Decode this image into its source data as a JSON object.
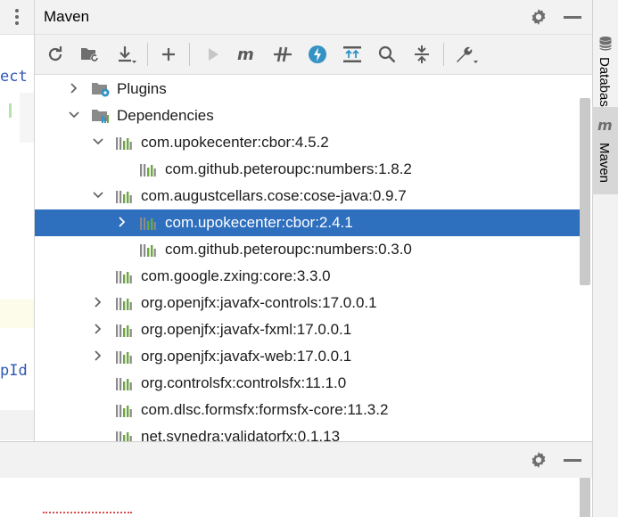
{
  "left_editor": {
    "lines": [
      {
        "text": "ect"
      },
      {
        "text": "pId"
      }
    ]
  },
  "maven": {
    "title": "Maven",
    "header_icons": [
      "gear-icon",
      "minimize-icon"
    ],
    "toolbar": [
      "reload-icon",
      "reimport-folder-icon",
      "download-icon",
      "add-icon",
      "run-icon",
      "maven-goal-icon",
      "toggle-offline-icon",
      "skip-tests-icon",
      "show-dependencies-icon",
      "search-icon",
      "collapse-all-icon",
      "settings-wrench-icon"
    ]
  },
  "tree": [
    {
      "label": "Plugins",
      "level": 1,
      "expanded": false,
      "icon": "plugins-folder-icon"
    },
    {
      "label": "Dependencies",
      "level": 1,
      "expanded": true,
      "icon": "dependencies-folder-icon"
    },
    {
      "label": "com.upokecenter:cbor:4.5.2",
      "level": 2,
      "expanded": true,
      "icon": "library-icon"
    },
    {
      "label": "com.github.peteroupc:numbers:1.8.2",
      "level": 3,
      "expanded": null,
      "icon": "library-icon"
    },
    {
      "label": "com.augustcellars.cose:cose-java:0.9.7",
      "level": 2,
      "expanded": true,
      "icon": "library-icon"
    },
    {
      "label": "com.upokecenter:cbor:2.4.1",
      "level": 3,
      "expanded": false,
      "icon": "library-icon",
      "selected": true
    },
    {
      "label": "com.github.peteroupc:numbers:0.3.0",
      "level": 3,
      "expanded": null,
      "icon": "library-icon"
    },
    {
      "label": "com.google.zxing:core:3.3.0",
      "level": 2,
      "expanded": null,
      "icon": "library-icon"
    },
    {
      "label": "org.openjfx:javafx-controls:17.0.0.1",
      "level": 2,
      "expanded": false,
      "icon": "library-icon"
    },
    {
      "label": "org.openjfx:javafx-fxml:17.0.0.1",
      "level": 2,
      "expanded": false,
      "icon": "library-icon"
    },
    {
      "label": "org.openjfx:javafx-web:17.0.0.1",
      "level": 2,
      "expanded": false,
      "icon": "library-icon"
    },
    {
      "label": "org.controlsfx:controlsfx:11.1.0",
      "level": 2,
      "expanded": null,
      "icon": "library-icon"
    },
    {
      "label": "com.dlsc.formsfx:formsfx-core:11.3.2",
      "level": 2,
      "expanded": null,
      "icon": "library-icon"
    },
    {
      "label": "net.synedra:validatorfx:0.1.13",
      "level": 2,
      "expanded": null,
      "icon": "library-icon"
    }
  ],
  "right_bar": {
    "tabs": [
      {
        "label": "Database"
      },
      {
        "label": "Maven",
        "active": true
      }
    ]
  },
  "colors": {
    "selection": "#2e6fbe",
    "accent_blue": "#3592c4",
    "library_green": "#6da741"
  }
}
